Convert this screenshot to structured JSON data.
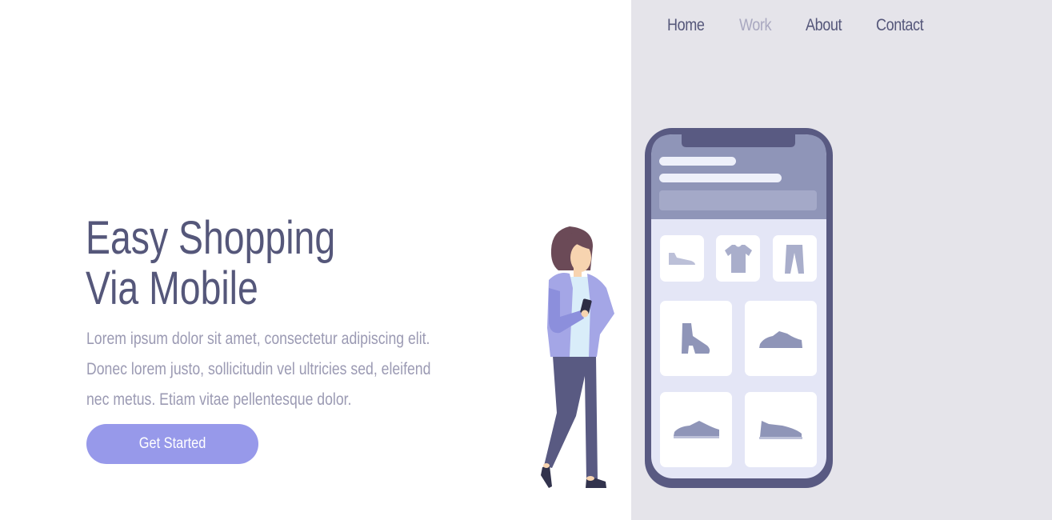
{
  "nav": {
    "items": [
      {
        "label": "Home",
        "active": false
      },
      {
        "label": "Work",
        "active": true
      },
      {
        "label": "About",
        "active": false
      },
      {
        "label": "Contact",
        "active": false
      }
    ]
  },
  "hero": {
    "title_line1": "Easy Shopping",
    "title_line2": "Via Mobile",
    "description": "Lorem ipsum dolor sit amet, consectetur adipiscing elit. Donec lorem justo, sollicitudin vel ultricies sed, eleifend nec metus. Etiam vitae pellentesque dolor.",
    "cta_label": "Get Started"
  },
  "colors": {
    "brand_dark": "#55577a",
    "accent": "#9799ea",
    "panel_bg": "#e5e4ea",
    "muted_text": "#9b9ab3"
  },
  "illustration": {
    "phone_categories": [
      "shoe-icon",
      "tshirt-icon",
      "pants-icon"
    ],
    "phone_products": [
      "boot-icon",
      "sneaker-icon",
      "sneaker-icon",
      "sneaker-icon"
    ]
  }
}
